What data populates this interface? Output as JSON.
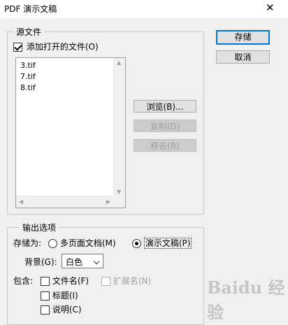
{
  "window": {
    "title": "PDF 演示文稿",
    "close_symbol": "✕"
  },
  "source": {
    "legend": "源文件",
    "add_open_files_label": "添加打开的文件(O)",
    "add_open_files_checked": true,
    "files": [
      "3.tif",
      "7.tif",
      "8.tif"
    ],
    "browse_label": "浏览(B)...",
    "duplicate_label": "复制(D)",
    "remove_label": "移去(R)"
  },
  "buttons": {
    "save_label": "存储",
    "cancel_label": "取消"
  },
  "output": {
    "legend": "输出选项",
    "save_as_label": "存储为:",
    "multipage_label": "多页面文档(M)",
    "presentation_label": "演示文稿(P)",
    "selected_mode": "presentation",
    "background_label": "背景(G):",
    "background_value": "白色",
    "include_label": "包含:",
    "filename_label": "文件名(F)",
    "extension_label": "扩展名(N)",
    "title_label": "标题(I)",
    "caption_label": "说明(C)"
  },
  "watermark": "Baidu 经验"
}
